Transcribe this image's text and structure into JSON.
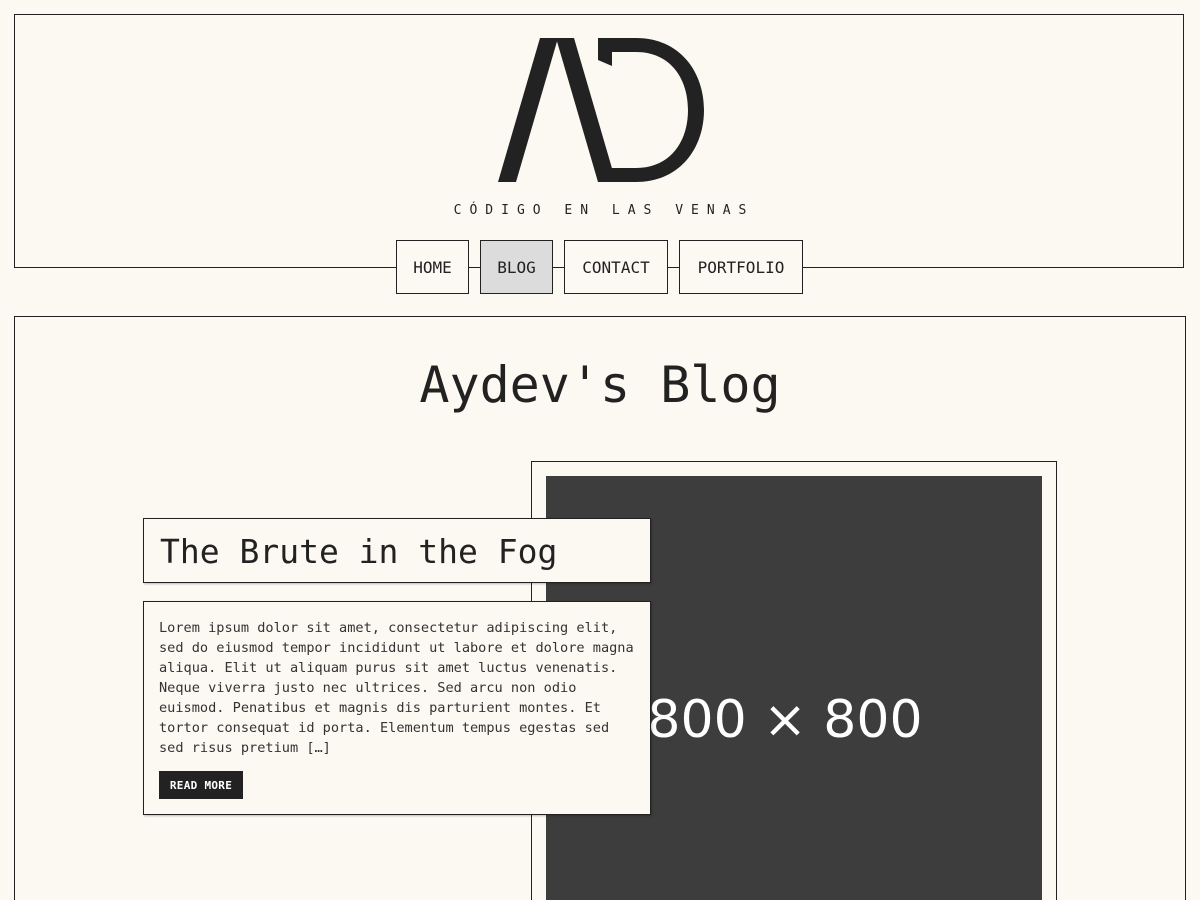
{
  "header": {
    "logo_text": "AD",
    "tagline": "CÓDIGO EN LAS VENAS"
  },
  "nav": {
    "items": [
      {
        "label": "HOME",
        "active": false
      },
      {
        "label": "BLOG",
        "active": true
      },
      {
        "label": "CONTACT",
        "active": false
      },
      {
        "label": "PORTFOLIO",
        "active": false
      }
    ]
  },
  "main": {
    "title": "Aydev's Blog",
    "post": {
      "title": "The Brute in the Fog",
      "excerpt": "Lorem ipsum dolor sit amet, consectetur adipiscing elit, sed do eiusmod tempor incididunt ut labore et dolore magna aliqua. Elit ut aliquam purus sit amet luctus venenatis. Neque viverra justo nec ultrices. Sed arcu non odio euismod. Penatibus et magnis dis parturient montes. Et tortor consequat id porta. Elementum tempus egestas sed sed risus pretium […]",
      "read_more": "READ MORE",
      "image_caption": "800 × 800"
    }
  },
  "colors": {
    "background": "#fcf9f3",
    "ink": "#222222",
    "active_nav": "#dcdcdc",
    "image_placeholder": "#3d3d3d"
  }
}
